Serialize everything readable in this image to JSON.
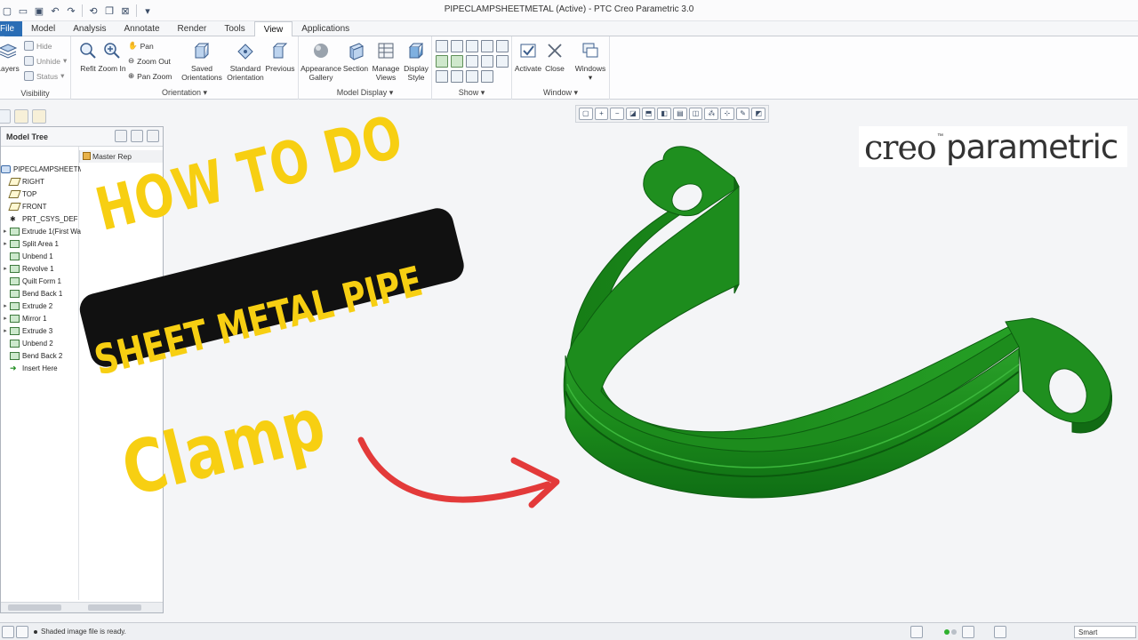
{
  "window": {
    "title": "PIPECLAMPSHEETMETAL (Active) - PTC Creo Parametric 3.0"
  },
  "tabs": [
    {
      "label": "File ▾"
    },
    {
      "label": "Model"
    },
    {
      "label": "Analysis"
    },
    {
      "label": "Annotate"
    },
    {
      "label": "Render"
    },
    {
      "label": "Tools"
    },
    {
      "label": "View"
    },
    {
      "label": "Applications"
    }
  ],
  "active_tab": "View",
  "ribbon": {
    "visibility": {
      "label": "Visibility",
      "layers": "Layers",
      "hide": "Hide",
      "unhide": "Unhide",
      "status": "Status"
    },
    "orientation": {
      "label": "Orientation",
      "refit": "Refit",
      "zoom_in": "Zoom In",
      "pan": "Pan",
      "zoom_out": "Zoom Out",
      "pan_zoom": "Pan Zoom",
      "saved_1": "Saved",
      "saved_2": "Orientations",
      "standard_1": "Standard",
      "standard_2": "Orientation",
      "previous": "Previous"
    },
    "model_display": {
      "label": "Model Display",
      "appearance_1": "Appearance",
      "appearance_2": "Gallery",
      "section": "Section",
      "manage_1": "Manage",
      "manage_2": "Views",
      "display_1": "Display",
      "display_2": "Style"
    },
    "show": {
      "label": "Show"
    },
    "window": {
      "label": "Window",
      "activate": "Activate",
      "close": "Close",
      "windows": "Windows"
    }
  },
  "model_tree": {
    "title": "Model Tree",
    "column": "Master Rep",
    "items": [
      {
        "label": "PIPECLAMPSHEETMET",
        "icon": "part-icon",
        "expandable": false
      },
      {
        "label": "RIGHT",
        "icon": "datum-plane-icon",
        "expandable": false
      },
      {
        "label": "TOP",
        "icon": "datum-plane-icon",
        "expandable": false
      },
      {
        "label": "FRONT",
        "icon": "datum-plane-icon",
        "expandable": false
      },
      {
        "label": "PRT_CSYS_DEF",
        "icon": "csys-icon",
        "expandable": false
      },
      {
        "label": "Extrude 1(First Wa",
        "icon": "extrude-icon",
        "expandable": true
      },
      {
        "label": "Split Area 1",
        "icon": "split-icon",
        "expandable": true
      },
      {
        "label": "Unbend 1",
        "icon": "unbend-icon",
        "expandable": false
      },
      {
        "label": "Revolve 1",
        "icon": "revolve-icon",
        "expandable": true
      },
      {
        "label": "Quilt Form 1",
        "icon": "quilt-icon",
        "expandable": false
      },
      {
        "label": "Bend Back 1",
        "icon": "bend-back-icon",
        "expandable": false
      },
      {
        "label": "Extrude 2",
        "icon": "extrude-icon",
        "expandable": true
      },
      {
        "label": "Mirror 1",
        "icon": "mirror-icon",
        "expandable": true
      },
      {
        "label": "Extrude 3",
        "icon": "extrude-icon",
        "expandable": true
      },
      {
        "label": "Unbend 2",
        "icon": "unbend-icon",
        "expandable": false
      },
      {
        "label": "Bend Back 2",
        "icon": "bend-back-icon",
        "expandable": false
      },
      {
        "label": "Insert Here",
        "icon": "insert-here-icon",
        "expandable": false
      }
    ]
  },
  "overlay": {
    "line1": "HOW TO DO",
    "line2": "SHEET METAL PIPE",
    "line3": "Clamp",
    "text_color": "#f7cf12",
    "badge_color": "#111111",
    "arrow_color": "#e33a3a"
  },
  "logo": {
    "word1": "creo",
    "tm": "™",
    "word2": "parametric"
  },
  "model": {
    "color": "#1f8f1f"
  },
  "status": {
    "message": "Shaded image file is ready.",
    "filter": "Smart"
  }
}
